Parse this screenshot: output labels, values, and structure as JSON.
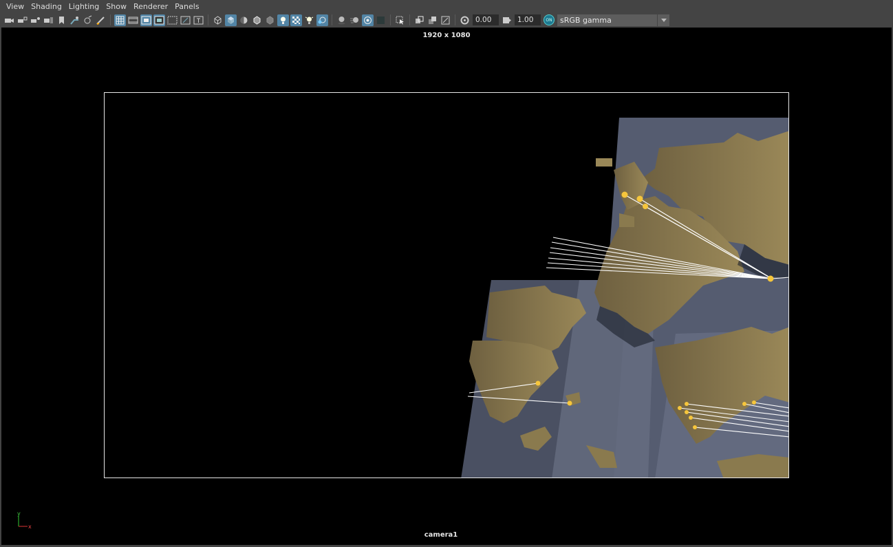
{
  "menu": [
    "View",
    "Shading",
    "Lighting",
    "Show",
    "Renderer",
    "Panels"
  ],
  "toolbar": {
    "exposure_value": "0.00",
    "gamma_value": "1.00",
    "color_management_label": "ON",
    "view_transform": "sRGB gamma"
  },
  "viewport": {
    "resolution": "1920 x 1080",
    "camera": "camera1",
    "axis_y": "y",
    "axis_x": "x"
  },
  "colors": {
    "land": "#8a7a4e",
    "sea_plane": "#5a6176",
    "marker": "#f6c63c",
    "line": "#ffffff"
  }
}
